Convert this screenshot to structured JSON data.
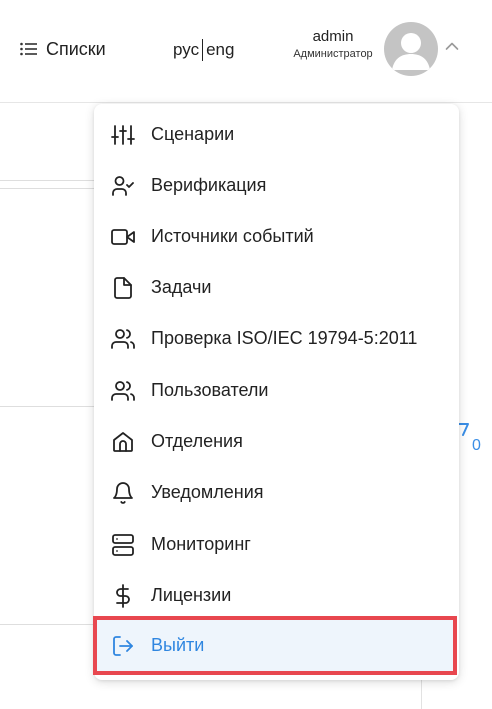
{
  "header": {
    "lists_label": "Списки",
    "lang_ru": "рус",
    "lang_en": "eng",
    "user_name": "admin",
    "user_role": "Администратор"
  },
  "background": {
    "counter": "0"
  },
  "menu": {
    "items": [
      {
        "label": "Сценарии",
        "icon": "sliders-icon"
      },
      {
        "label": "Верификация",
        "icon": "user-check-icon"
      },
      {
        "label": "Источники событий",
        "icon": "video-camera-icon"
      },
      {
        "label": "Задачи",
        "icon": "file-icon"
      },
      {
        "label": "Проверка ISO/IEC 19794-5:2011",
        "icon": "users-icon"
      },
      {
        "label": "Пользователи",
        "icon": "users-icon"
      },
      {
        "label": "Отделения",
        "icon": "home-icon"
      },
      {
        "label": "Уведомления",
        "icon": "bell-icon"
      },
      {
        "label": "Мониторинг",
        "icon": "server-icon"
      },
      {
        "label": "Лицензии",
        "icon": "dollar-icon"
      }
    ],
    "logout_label": "Выйти",
    "logout_icon": "logout-icon"
  },
  "colors": {
    "accent": "#2f86e0",
    "highlight_border": "#e8474f",
    "logout_bg": "#eef5fc",
    "avatar": "#c4c4c4"
  }
}
